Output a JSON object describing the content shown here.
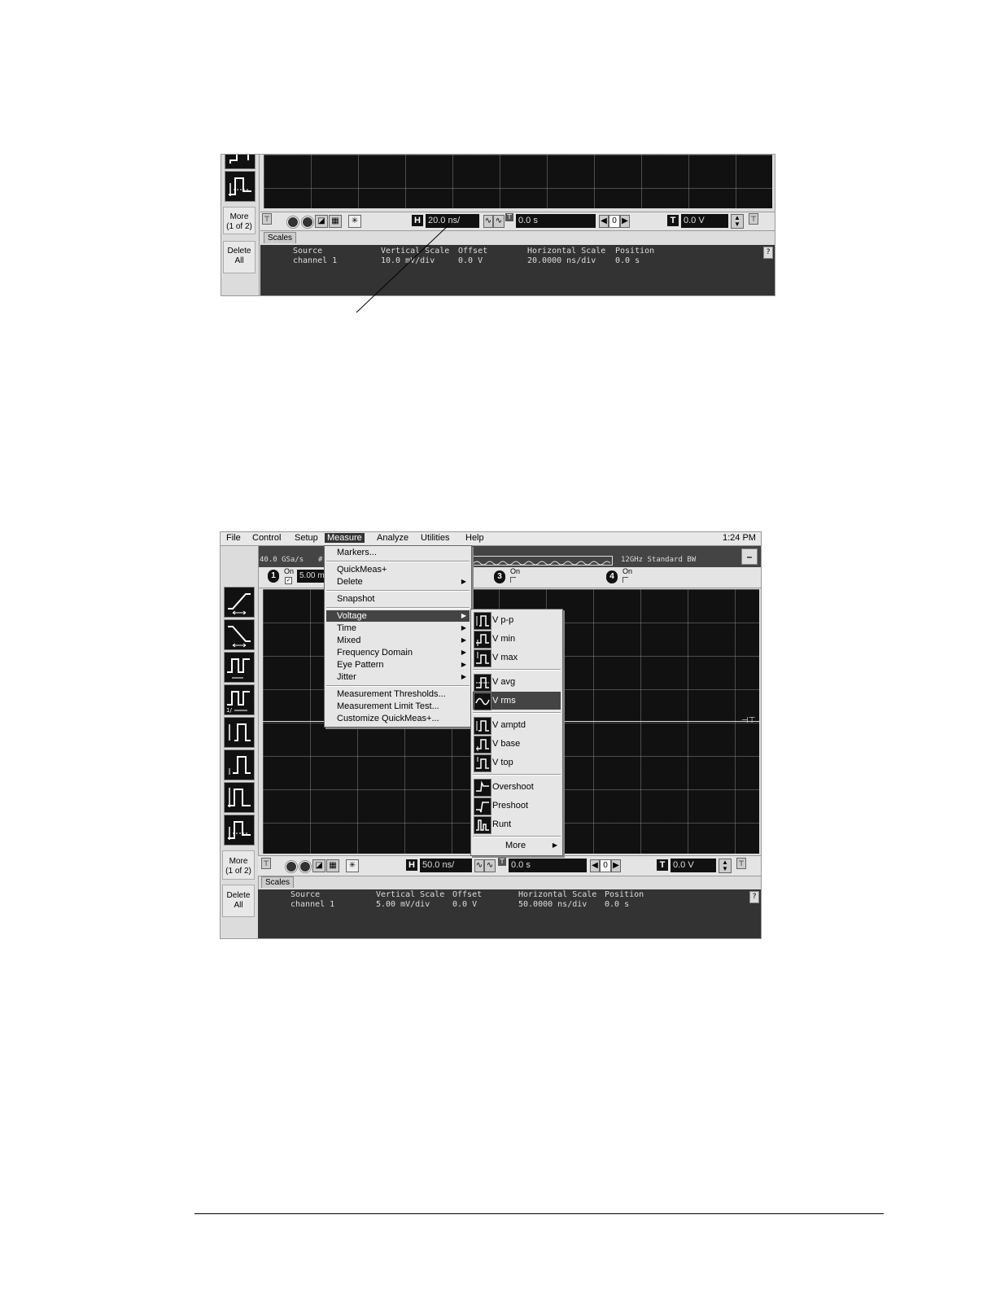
{
  "screenshot1": {
    "more_button": {
      "line1": "More",
      "line2": "(1 of 2)"
    },
    "delete_button": {
      "line1": "Delete",
      "line2": "All"
    },
    "horizontal_scale_value": "20.0 ns/",
    "horizontal_position_value": "0.0 s",
    "horizontal_label": "H",
    "trigger_label": "T",
    "trigger_level_value": "0.0 V",
    "step_value": "0",
    "scales_tab": "Scales",
    "help_button": "?",
    "info_headers": {
      "source": "Source",
      "vertical_scale": "Vertical Scale",
      "offset": "Offset",
      "horizontal_scale": "Horizontal Scale",
      "position": "Position"
    },
    "info_values": {
      "source": "channel 1",
      "vertical_scale": "10.0 mV/div",
      "offset": "0.0 V",
      "horizontal_scale": "20.0000 ns/div",
      "position": "0.0 s"
    }
  },
  "screenshot2": {
    "menubar": [
      "File",
      "Control",
      "Setup",
      "Measure",
      "Analyze",
      "Utilities",
      "Help"
    ],
    "clock": "1:24 PM",
    "sample_rate": "40.0 GSa/s",
    "sample_rate_extra": "#",
    "bandwidth": "12GHz Standard BW",
    "minimize_button": "–",
    "channels": {
      "ch1": {
        "number": "1",
        "on_label": "On",
        "scale_value": "5.00 m"
      },
      "ch3": {
        "number": "3",
        "on_label": "On"
      },
      "ch4": {
        "number": "4",
        "on_label": "On"
      }
    },
    "measure_menu": {
      "markers": "Markers...",
      "quickmeas": "QuickMeas+",
      "delete": "Delete",
      "snapshot": "Snapshot",
      "voltage": "Voltage",
      "time": "Time",
      "mixed": "Mixed",
      "frequency_domain": "Frequency Domain",
      "eye_pattern": "Eye Pattern",
      "jitter": "Jitter",
      "thresholds": "Measurement Thresholds...",
      "limit_test": "Measurement Limit Test...",
      "customize": "Customize QuickMeas+..."
    },
    "voltage_submenu": {
      "vpp": "V p-p",
      "vmin": "V min",
      "vmax": "V max",
      "vavg": "V avg",
      "vrms": "V rms",
      "vamptd": "V amptd",
      "vbase": "V base",
      "vtop": "V top",
      "overshoot": "Overshoot",
      "preshoot": "Preshoot",
      "runt": "Runt",
      "more": "More"
    },
    "more_button": {
      "line1": "More",
      "line2": "(1 of 2)"
    },
    "delete_button": {
      "line1": "Delete",
      "line2": "All"
    },
    "horizontal_label": "H",
    "horizontal_scale_value": "50.0 ns/",
    "horizontal_position_value": "0.0 s",
    "trigger_label": "T",
    "trigger_level_value": "0.0 V",
    "step_value": "0",
    "scales_tab": "Scales",
    "help_button": "?",
    "info_headers": {
      "source": "Source",
      "vertical_scale": "Vertical Scale",
      "offset": "Offset",
      "horizontal_scale": "Horizontal Scale",
      "position": "Position"
    },
    "info_values": {
      "source": "channel 1",
      "vertical_scale": "5.00 mV/div",
      "offset": "0.0 V",
      "horizontal_scale": "50.0000 ns/div",
      "position": "0.0 s"
    }
  }
}
